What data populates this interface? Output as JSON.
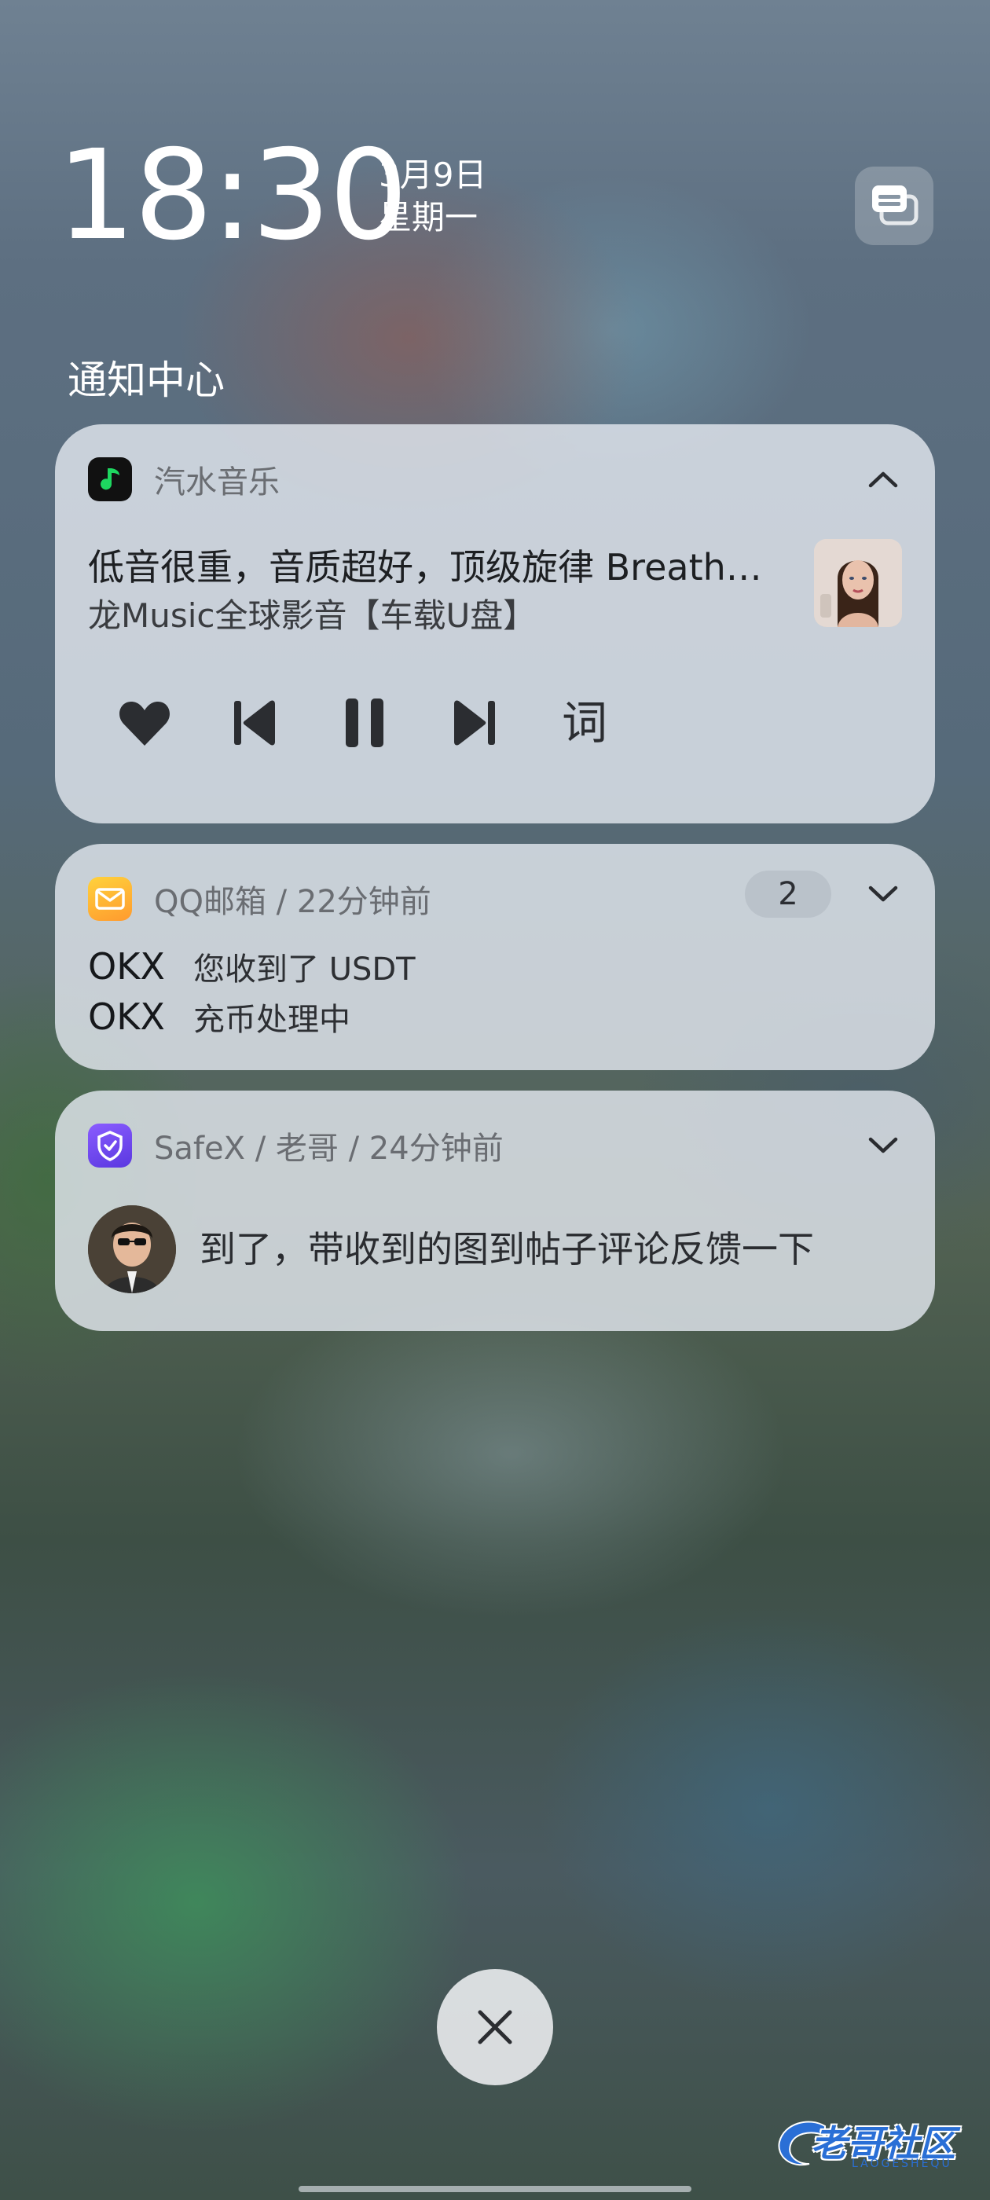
{
  "status": {
    "time": "18:30",
    "date": "3月9日",
    "weekday": "星期一"
  },
  "notification_center": {
    "title": "通知中心"
  },
  "music": {
    "app_name": "汽水音乐",
    "track_title": "低音很重，音质超好，顶级旋律 Breath…",
    "artist": "龙Music全球影音【车载U盘】",
    "lyric_button": "词",
    "icons": [
      "heart-icon",
      "previous-icon",
      "pause-icon",
      "next-icon"
    ],
    "app_color": "#1ed760"
  },
  "mail": {
    "header": "QQ邮箱 / 22分钟前",
    "count": "2",
    "items": [
      {
        "sender": "OKX",
        "text": "您收到了 USDT"
      },
      {
        "sender": "OKX",
        "text": "充币处理中"
      }
    ]
  },
  "safex": {
    "header": "SafeX / 老哥 / 24分钟前",
    "message": "到了，带收到的图到帖子评论反馈一下"
  },
  "watermark": {
    "text": "老哥社区",
    "sub": "LAOGESHEQU"
  }
}
